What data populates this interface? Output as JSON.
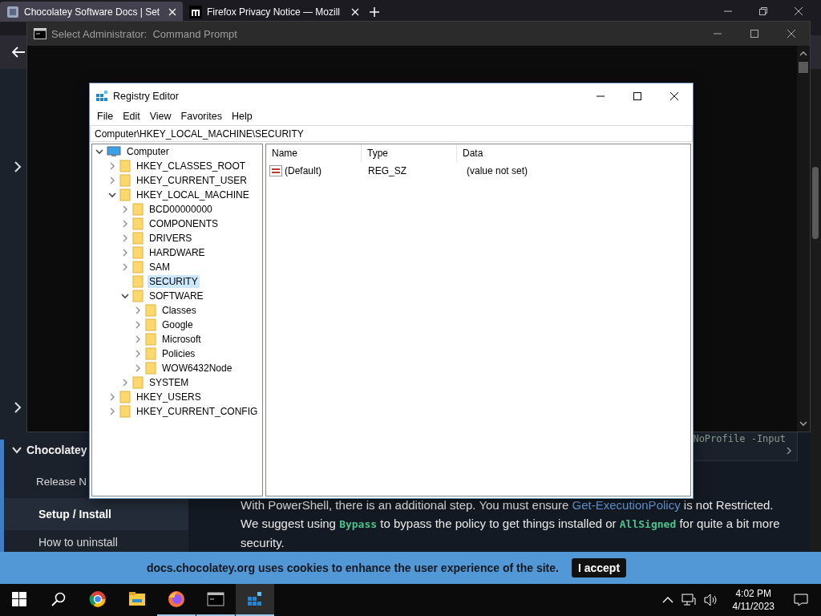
{
  "browser": {
    "tabs": [
      {
        "title": "Chocolatey Software Docs | Set",
        "selected": true
      },
      {
        "title": "Firefox Privacy Notice — Mozill",
        "selected": false
      }
    ],
    "sidebar": {
      "section": "Chocolatey",
      "expanded": true,
      "items": [
        {
          "label": "Release N",
          "selected": false
        },
        {
          "label": "Setup / Install",
          "selected": true
        },
        {
          "label": "How to uninstall",
          "selected": false
        }
      ]
    },
    "code_snippet": "NoProfile -Input",
    "paragraph": [
      {
        "kind": "text",
        "text": "With PowerShell, there is an additional step. You must ensure "
      },
      {
        "kind": "link",
        "text": "Get-ExecutionPolicy"
      },
      {
        "kind": "text",
        "text": " is not Restricted. We suggest using "
      },
      {
        "kind": "code",
        "text": "Bypass"
      },
      {
        "kind": "text",
        "text": " to bypass the policy to get things installed or "
      },
      {
        "kind": "code",
        "text": "AllSigned"
      },
      {
        "kind": "text",
        "text": " for quite a bit more security."
      }
    ],
    "cookie_banner": {
      "message": "docs.chocolatey.org uses cookies to enhance the user experience of the site.",
      "button": "I accept"
    }
  },
  "command_prompt": {
    "title": "Select Administrator:  Command Prompt"
  },
  "registry_editor": {
    "title": "Registry Editor",
    "menu": [
      "File",
      "Edit",
      "View",
      "Favorites",
      "Help"
    ],
    "address": "Computer\\HKEY_LOCAL_MACHINE\\SECURITY",
    "tree": [
      {
        "label": "Computer",
        "kind": "computer",
        "expanded": true,
        "selected": false,
        "children": [
          {
            "label": "HKEY_CLASSES_ROOT",
            "expanded": false,
            "selected": false
          },
          {
            "label": "HKEY_CURRENT_USER",
            "expanded": false,
            "selected": false
          },
          {
            "label": "HKEY_LOCAL_MACHINE",
            "expanded": true,
            "selected": false,
            "children": [
              {
                "label": "BCD00000000",
                "expanded": false,
                "selected": false
              },
              {
                "label": "COMPONENTS",
                "expanded": false,
                "selected": false
              },
              {
                "label": "DRIVERS",
                "expanded": false,
                "selected": false
              },
              {
                "label": "HARDWARE",
                "expanded": false,
                "selected": false
              },
              {
                "label": "SAM",
                "expanded": false,
                "selected": false
              },
              {
                "label": "SECURITY",
                "selected": true
              },
              {
                "label": "SOFTWARE",
                "expanded": true,
                "selected": false,
                "children": [
                  {
                    "label": "Classes",
                    "expanded": false,
                    "selected": false
                  },
                  {
                    "label": "Google",
                    "expanded": false,
                    "selected": false
                  },
                  {
                    "label": "Microsoft",
                    "expanded": false,
                    "selected": false
                  },
                  {
                    "label": "Policies",
                    "expanded": false,
                    "selected": false
                  },
                  {
                    "label": "WOW6432Node",
                    "expanded": false,
                    "selected": false
                  }
                ]
              },
              {
                "label": "SYSTEM",
                "expanded": false,
                "selected": false
              }
            ]
          },
          {
            "label": "HKEY_USERS",
            "expanded": false,
            "selected": false
          },
          {
            "label": "HKEY_CURRENT_CONFIG",
            "expanded": false,
            "selected": false
          }
        ]
      }
    ],
    "columns": [
      "Name",
      "Type",
      "Data"
    ],
    "values": [
      {
        "name": "(Default)",
        "type": "REG_SZ",
        "data": "(value not set)"
      }
    ]
  },
  "taskbar": {
    "apps": [
      {
        "kind": "chrome",
        "running": false,
        "active": false
      },
      {
        "kind": "explorer",
        "running": false,
        "active": false
      },
      {
        "kind": "firefox",
        "running": true,
        "active": false
      },
      {
        "kind": "terminal",
        "running": true,
        "active": false
      },
      {
        "kind": "registry",
        "running": true,
        "active": true
      }
    ],
    "time": "4:02 PM",
    "date": "4/11/2023"
  }
}
